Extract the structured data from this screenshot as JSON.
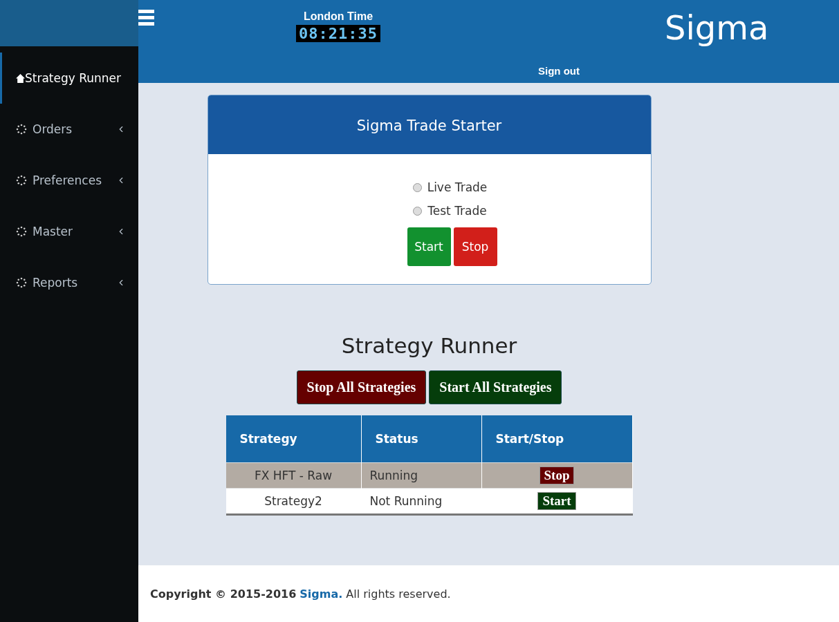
{
  "header": {
    "clock_label": "London Time",
    "clock": "08:21:35",
    "brand": "Sigma",
    "sign_out": "Sign out"
  },
  "sidebar": {
    "items": [
      {
        "label": "Strategy Runner",
        "selected": true,
        "kind": "home"
      },
      {
        "label": "Orders",
        "selected": false,
        "kind": "menu"
      },
      {
        "label": "Preferences",
        "selected": false,
        "kind": "menu"
      },
      {
        "label": "Master",
        "selected": false,
        "kind": "menu"
      },
      {
        "label": "Reports",
        "selected": false,
        "kind": "menu"
      }
    ]
  },
  "starter": {
    "title": "Sigma Trade Starter",
    "modes": [
      {
        "label": "Live Trade",
        "selected": false
      },
      {
        "label": "Test Trade",
        "selected": false
      }
    ],
    "buttons": [
      {
        "label": "Start",
        "kind": "start"
      },
      {
        "label": "Stop",
        "kind": "stop"
      }
    ]
  },
  "runner": {
    "title": "Strategy Runner",
    "buttons": [
      {
        "label": "Stop All Strategies",
        "kind": "stop"
      },
      {
        "label": "Start All Strategies",
        "kind": "start"
      }
    ],
    "columns": [
      "Strategy",
      "Status",
      "Start/Stop"
    ],
    "rows": [
      {
        "strategy": "FX HFT - Raw",
        "status": "Running",
        "highlighted": true,
        "action": {
          "label": "Stop",
          "kind": "stop"
        }
      },
      {
        "strategy": "Strategy2",
        "status": "Not Running",
        "highlighted": false,
        "action": {
          "label": "Start",
          "kind": "start"
        }
      }
    ]
  },
  "footer": {
    "prefix": "Copyright © 2015-2016",
    "link": "Sigma.",
    "suffix": "All rights reserved."
  }
}
